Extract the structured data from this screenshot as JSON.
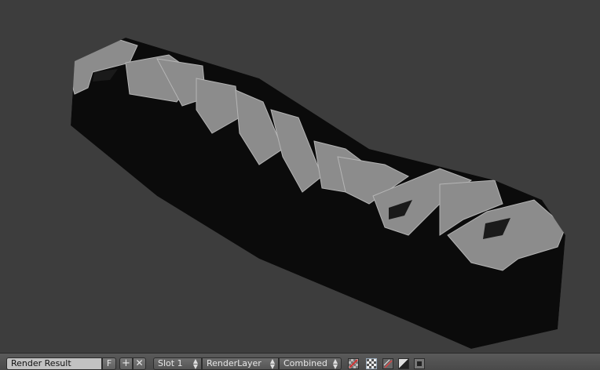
{
  "viewport": {
    "render_text": "ABSANAFER",
    "background": "#3d3d3d",
    "face_color": "#8c8c8c",
    "extrude_color": "#0b0b0b"
  },
  "header": {
    "image_name_value": "Render Result",
    "fake_user_label": "F",
    "slot_value": "Slot 1",
    "layer_value": "RenderLayer",
    "pass_value": "Combined",
    "icons": [
      "add-icon",
      "close-icon",
      "alpha-checker-icon",
      "color-alpha-icon",
      "split-channel-icon",
      "z-buffer-icon",
      "zoom-box-icon"
    ]
  }
}
